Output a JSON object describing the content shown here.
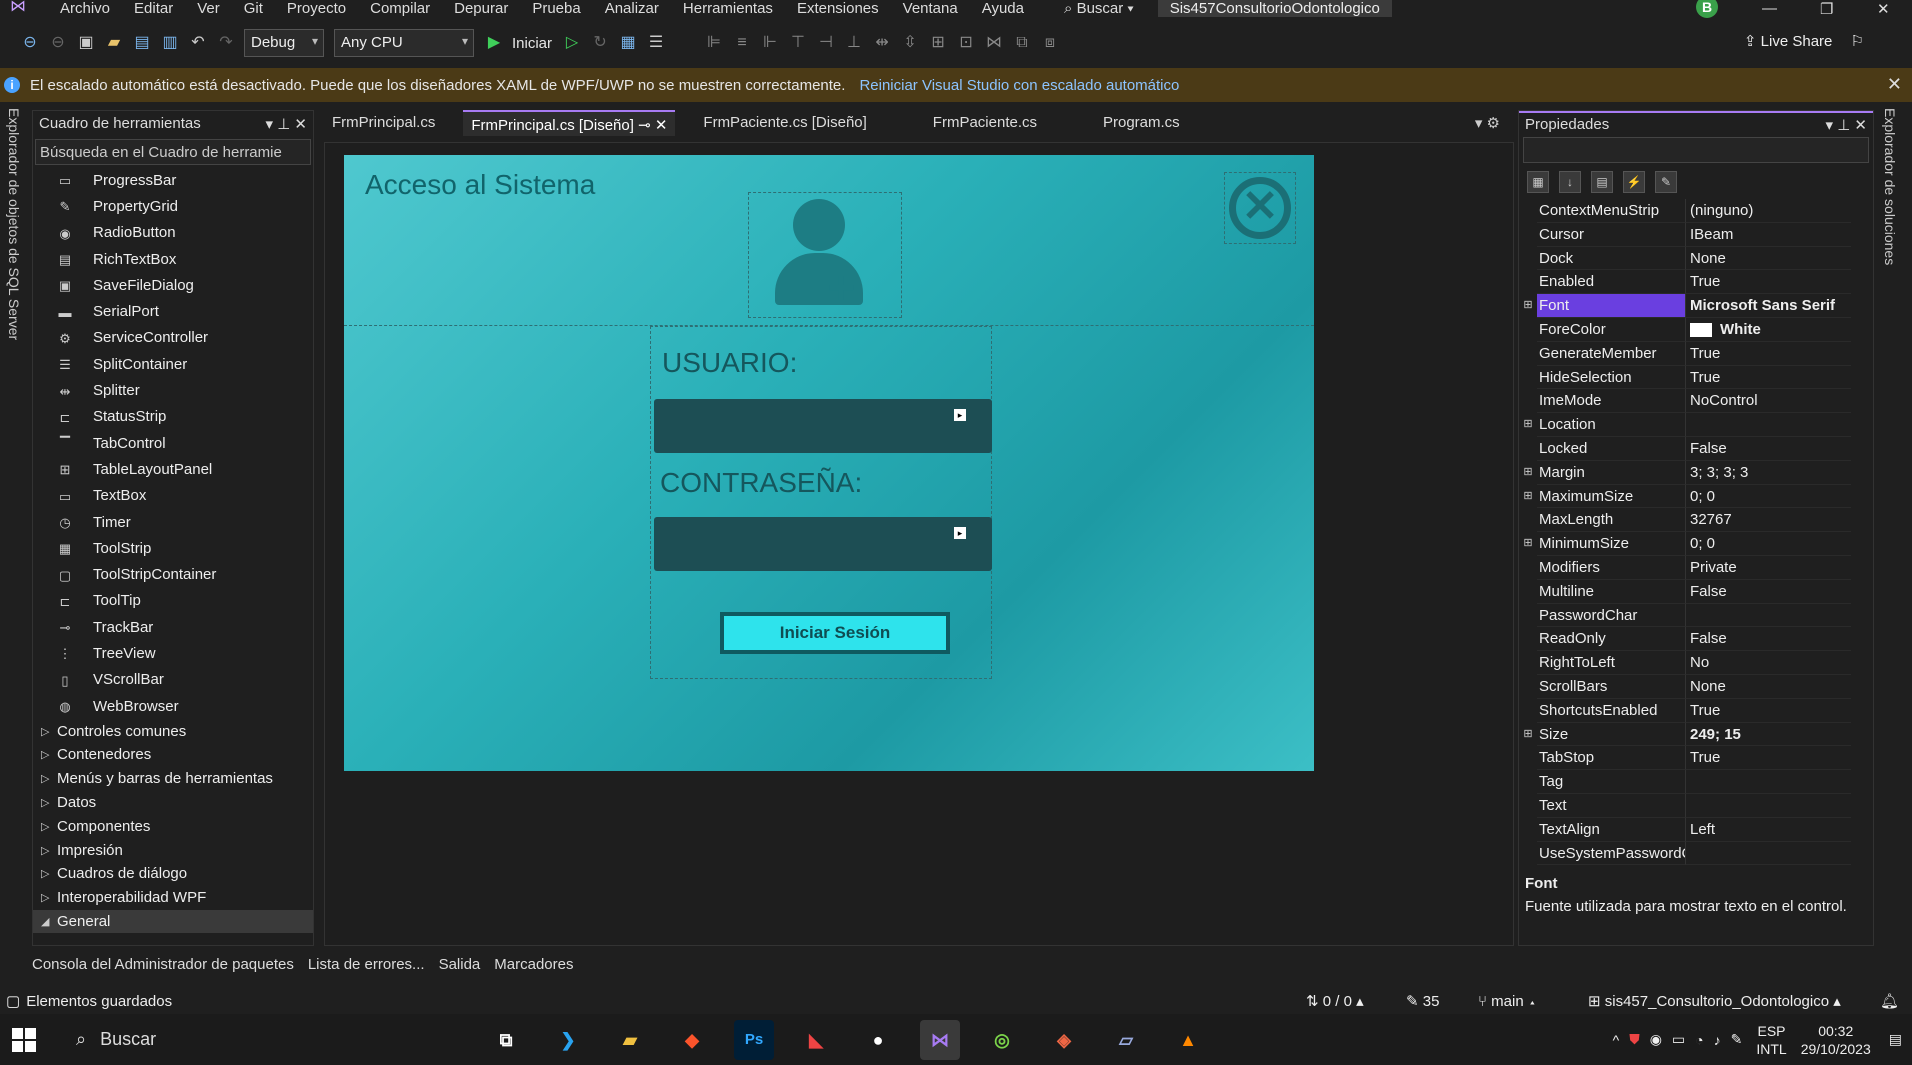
{
  "app": {
    "menu": [
      "Archivo",
      "Editar",
      "Ver",
      "Git",
      "Proyecto",
      "Compilar",
      "Depurar",
      "Prueba",
      "Analizar",
      "Herramientas",
      "Extensiones",
      "Ventana",
      "Ayuda"
    ],
    "search_label": "Buscar",
    "solution_title": "Sis457ConsultorioOdontologico",
    "avatar_letter": "B"
  },
  "toolbar": {
    "config": "Debug",
    "platform": "Any CPU",
    "start_label": "Iniciar",
    "live_share": "Live Share"
  },
  "infobar": {
    "message": "El escalado automático está desactivado. Puede que los diseñadores XAML de WPF/UWP no se muestren correctamente.",
    "link": "Reiniciar Visual Studio con escalado automático"
  },
  "side_tabs": {
    "left": "Explorador de objetos de SQL Server",
    "right": "Explorador de soluciones"
  },
  "toolbox": {
    "title": "Cuadro de herramientas",
    "search_placeholder": "Búsqueda en el Cuadro de herramie",
    "items": [
      "ProgressBar",
      "PropertyGrid",
      "RadioButton",
      "RichTextBox",
      "SaveFileDialog",
      "SerialPort",
      "ServiceController",
      "SplitContainer",
      "Splitter",
      "StatusStrip",
      "TabControl",
      "TableLayoutPanel",
      "TextBox",
      "Timer",
      "ToolStrip",
      "ToolStripContainer",
      "ToolTip",
      "TrackBar",
      "TreeView",
      "VScrollBar",
      "WebBrowser"
    ],
    "categories": [
      "Controles comunes",
      "Contenedores",
      "Menús y barras de herramientas",
      "Datos",
      "Componentes",
      "Impresión",
      "Cuadros de diálogo",
      "Interoperabilidad WPF",
      "General"
    ]
  },
  "tabs": [
    "FrmPrincipal.cs",
    "FrmPrincipal.cs [Diseño]",
    "FrmPaciente.cs [Diseño]",
    "FrmPaciente.cs",
    "Program.cs"
  ],
  "form": {
    "title": "Acceso al Sistema",
    "usuario_label": "USUARIO:",
    "password_label": "CONTRASEÑA:",
    "login_button": "Iniciar Sesión"
  },
  "properties": {
    "title": "Propiedades",
    "rows": [
      {
        "name": "ContextMenuStrip",
        "value": "(ninguno)",
        "exp": ""
      },
      {
        "name": "Cursor",
        "value": "IBeam",
        "exp": ""
      },
      {
        "name": "Dock",
        "value": "None",
        "exp": ""
      },
      {
        "name": "Enabled",
        "value": "True",
        "exp": ""
      },
      {
        "name": "Font",
        "value": "Microsoft Sans Serif",
        "exp": "⊞"
      },
      {
        "name": "ForeColor",
        "value": "White",
        "exp": ""
      },
      {
        "name": "GenerateMember",
        "value": "True",
        "exp": ""
      },
      {
        "name": "HideSelection",
        "value": "True",
        "exp": ""
      },
      {
        "name": "ImeMode",
        "value": "NoControl",
        "exp": ""
      },
      {
        "name": "Location",
        "value": "",
        "exp": "⊞"
      },
      {
        "name": "Locked",
        "value": "False",
        "exp": ""
      },
      {
        "name": "Margin",
        "value": "3; 3; 3; 3",
        "exp": "⊞"
      },
      {
        "name": "MaximumSize",
        "value": "0; 0",
        "exp": "⊞"
      },
      {
        "name": "MaxLength",
        "value": "32767",
        "exp": ""
      },
      {
        "name": "MinimumSize",
        "value": "0; 0",
        "exp": "⊞"
      },
      {
        "name": "Modifiers",
        "value": "Private",
        "exp": ""
      },
      {
        "name": "Multiline",
        "value": "False",
        "exp": ""
      },
      {
        "name": "PasswordChar",
        "value": "",
        "exp": ""
      },
      {
        "name": "ReadOnly",
        "value": "False",
        "exp": ""
      },
      {
        "name": "RightToLeft",
        "value": "No",
        "exp": ""
      },
      {
        "name": "ScrollBars",
        "value": "None",
        "exp": ""
      },
      {
        "name": "ShortcutsEnabled",
        "value": "True",
        "exp": ""
      },
      {
        "name": "Size",
        "value": "249; 15",
        "exp": "⊞"
      },
      {
        "name": "TabStop",
        "value": "True",
        "exp": ""
      },
      {
        "name": "Tag",
        "value": "",
        "exp": ""
      },
      {
        "name": "Text",
        "value": "",
        "exp": ""
      },
      {
        "name": "TextAlign",
        "value": "Left",
        "exp": ""
      },
      {
        "name": "UseSystemPasswordC",
        "value": "",
        "exp": ""
      }
    ],
    "desc_title": "Font",
    "desc_text": "Fuente utilizada para mostrar texto en el control."
  },
  "bottom_tabs": [
    "Consola del Administrador de paquetes",
    "Lista de errores...",
    "Salida",
    "Marcadores"
  ],
  "status": {
    "left": "Elementos guardados",
    "errors": "0 / 0",
    "pencil": "35",
    "branch": "main",
    "repo": "sis457_Consultorio_Odontologico"
  },
  "taskbar": {
    "search": "Buscar",
    "lang1": "ESP",
    "lang2": "INTL",
    "time": "00:32",
    "date": "29/10/2023"
  }
}
